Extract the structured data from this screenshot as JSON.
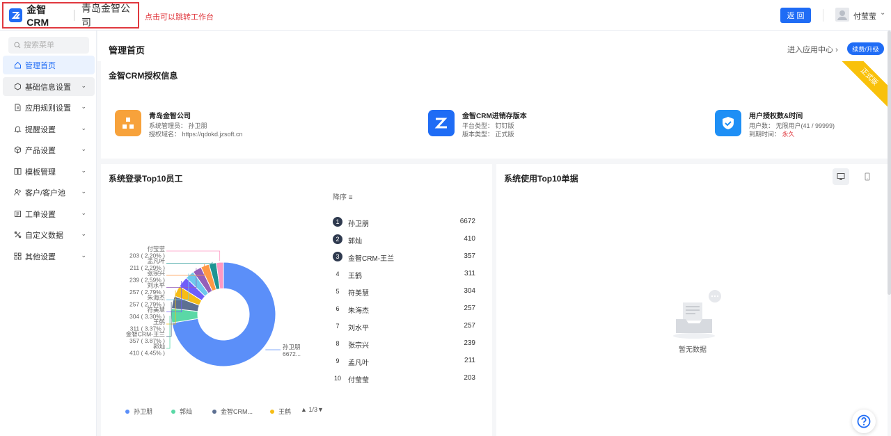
{
  "topbar": {
    "brand": "金智CRM",
    "company": "青岛金智公司",
    "tip": "点击可以跳转工作台",
    "back_label": "返 回",
    "user": "付莹莹"
  },
  "sidebar": {
    "search_placeholder": "搜索菜单",
    "items": [
      {
        "label": "管理首页"
      },
      {
        "label": "基础信息设置"
      },
      {
        "label": "应用规则设置"
      },
      {
        "label": "提醒设置"
      },
      {
        "label": "产品设置"
      },
      {
        "label": "模板管理"
      },
      {
        "label": "客户/客户池"
      },
      {
        "label": "工单设置"
      },
      {
        "label": "自定义数据"
      },
      {
        "label": "其他设置"
      }
    ]
  },
  "header": {
    "title": "管理首页",
    "enter_link": "进入应用中心",
    "renew_label": "续费/升级"
  },
  "auth": {
    "title": "金智CRM授权信息",
    "ribbon": "正式版",
    "blocks": [
      {
        "name": "青岛金智公司",
        "line1": "系统管理员： 孙卫朋",
        "line2": "授权域名： https://qdokd.jzsoft.cn"
      },
      {
        "name": "金智CRM进销存版本",
        "line1": "平台类型： 钉钉版",
        "line2": "版本类型： 正式版"
      },
      {
        "name": "用户授权数&时间",
        "line1": "用户数： 无限用户(41 / 99999)",
        "line2_label": "到期时间：",
        "line2_value": "永久"
      }
    ]
  },
  "login_top10": {
    "title": "系统登录Top10员工",
    "sort_label": "降序",
    "pager": "1/3",
    "legend": [
      "孙卫朋",
      "郭灿",
      "金智CRM...",
      "王鹤"
    ],
    "rank_numbers": [
      "1",
      "2",
      "3",
      "4",
      "5",
      "6",
      "7",
      "8",
      "9",
      "10"
    ],
    "pie_labels": [
      {
        "name": "孙卫朋",
        "text": "6672..."
      },
      {
        "name": "郭灿",
        "text": "410 ( 4.45% )"
      },
      {
        "name": "金智CRM-王兰",
        "text": "357 ( 3.87% )"
      },
      {
        "name": "王鹤",
        "text": "311 ( 3.37% )"
      },
      {
        "name": "符美慧",
        "text": "304 ( 3.30% )"
      },
      {
        "name": "朱海杰",
        "text": "257 ( 2.79% )"
      },
      {
        "name": "刘水平",
        "text": "257 ( 2.79% )"
      },
      {
        "name": "张宗兴",
        "text": "239 ( 2.59% )"
      },
      {
        "name": "孟凡叶",
        "text": "211 ( 2.29% )"
      },
      {
        "name": "付莹莹",
        "text": "203 ( 2.20% )"
      }
    ]
  },
  "usage_top10": {
    "title": "系统使用Top10单据",
    "empty_text": "暂无数据"
  },
  "chart_data": {
    "type": "pie",
    "categories": [
      "孙卫朋",
      "郭灿",
      "金智CRM-王兰",
      "王鹤",
      "符美慧",
      "朱海杰",
      "刘水平",
      "张宗兴",
      "孟凡叶",
      "付莹莹"
    ],
    "values": [
      6672,
      410,
      357,
      311,
      304,
      257,
      257,
      239,
      211,
      203
    ],
    "percentages": [
      72.37,
      4.45,
      3.87,
      3.37,
      3.3,
      2.79,
      2.79,
      2.59,
      2.29,
      2.2
    ],
    "colors": [
      "#5b8ff9",
      "#5ad8a6",
      "#5d7092",
      "#f6bd16",
      "#6f5ef9",
      "#6dc8ec",
      "#945fb9",
      "#ff9845",
      "#1e9493",
      "#ff99c3"
    ],
    "donut": true,
    "legend": "bottom"
  }
}
